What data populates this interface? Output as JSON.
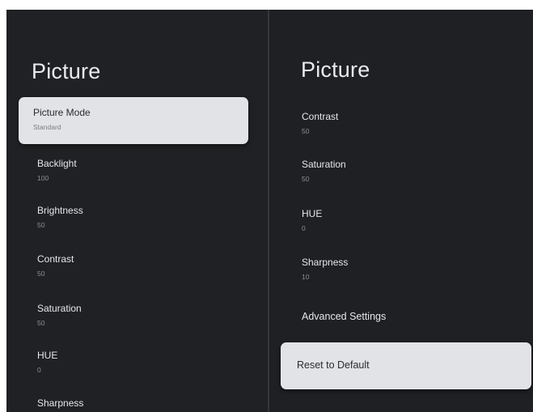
{
  "left_panel": {
    "title": "Picture",
    "items": [
      {
        "label": "Picture Mode",
        "value": "Standard"
      },
      {
        "label": "Backlight",
        "value": "100"
      },
      {
        "label": "Brightness",
        "value": "50"
      },
      {
        "label": "Contrast",
        "value": "50"
      },
      {
        "label": "Saturation",
        "value": "50"
      },
      {
        "label": "HUE",
        "value": "0"
      },
      {
        "label": "Sharpness",
        "value": ""
      }
    ]
  },
  "right_panel": {
    "title": "Picture",
    "items": [
      {
        "label": "Contrast",
        "value": "50"
      },
      {
        "label": "Saturation",
        "value": "50"
      },
      {
        "label": "HUE",
        "value": "0"
      },
      {
        "label": "Sharpness",
        "value": "10"
      },
      {
        "label": "Advanced Settings",
        "value": ""
      }
    ],
    "reset_label": "Reset to Default"
  },
  "colors": {
    "background": "#202124",
    "selected_background": "#e2e3e6",
    "text_primary": "#e8eaed",
    "text_secondary": "#8c8f95"
  }
}
